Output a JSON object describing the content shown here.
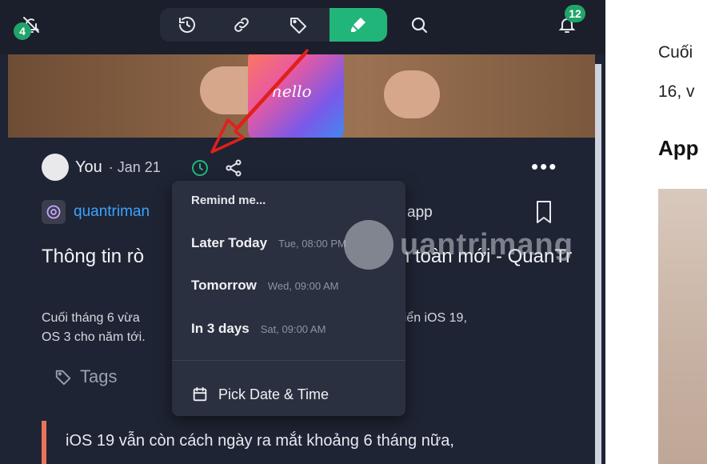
{
  "toolbar": {
    "left_badge": "4",
    "notif_badge": "12",
    "buttons": [
      "history-icon",
      "link-icon",
      "tag-icon",
      "highlighter-icon",
      "search-icon",
      "bell-icon"
    ]
  },
  "hero": {
    "phone_text": "hello"
  },
  "post": {
    "author": "You",
    "date": "· Jan 21",
    "source_name": "quantriman",
    "source_tail": "app",
    "title": "Thông tin rò                                     kế hoàn toàn mới - QuanTr",
    "summary": "Cuối tháng 6 vừa                                    Apple đã bắt đầu phát triển iOS 19,                                   OS 3 cho năm tới.",
    "tags_label": "Tags",
    "quote": "iOS 19 vẫn còn cách ngày ra mắt khoảng 6 tháng nữa,"
  },
  "remind": {
    "header": "Remind me...",
    "options": [
      {
        "label": "Later Today",
        "when": "Tue, 08:00 PM"
      },
      {
        "label": "Tomorrow",
        "when": "Wed, 09:00 AM"
      },
      {
        "label": "In 3 days",
        "when": "Sat, 09:00 AM"
      }
    ],
    "pick": "Pick Date & Time"
  },
  "watermark": "uantrimang",
  "right_pane": {
    "line1": "Cuối",
    "line2": "16, v",
    "heading": "App"
  },
  "colors": {
    "accent": "#22b57a",
    "link": "#3aa4ff",
    "annotation": "#e0201b"
  }
}
